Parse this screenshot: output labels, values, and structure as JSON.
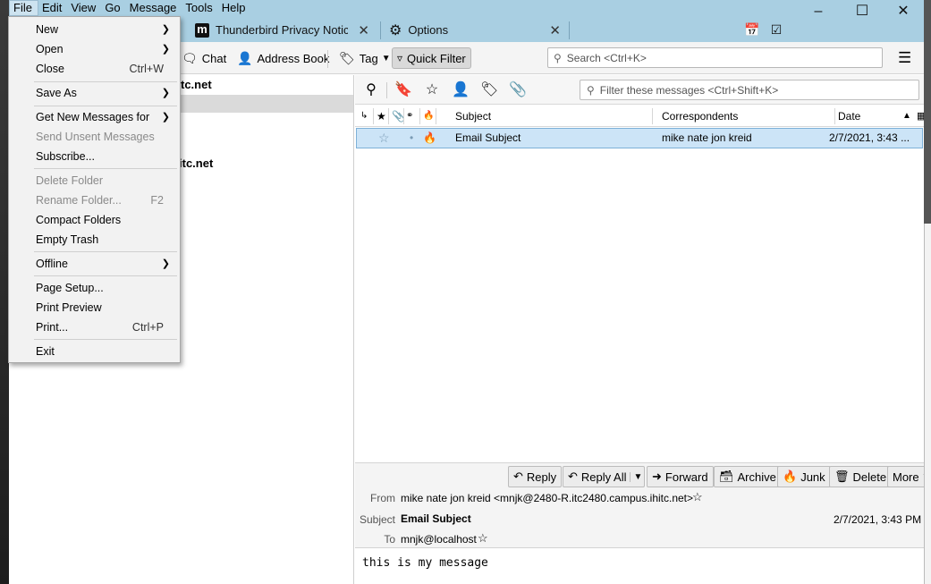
{
  "menubar": [
    "File",
    "Edit",
    "View",
    "Go",
    "Message",
    "Tools",
    "Help"
  ],
  "tabs": {
    "privacy": "Thunderbird Privacy Notice",
    "options": "Options"
  },
  "toolbar": {
    "chat": "Chat",
    "address_book": "Address Book",
    "tag": "Tag",
    "quick_filter": "Quick Filter",
    "search_placeholder": "Search <Ctrl+K>"
  },
  "folders": {
    "account1_suffix": "tc.net",
    "account2_suffix": "itc.net"
  },
  "quick_filter_bar": {
    "filter_placeholder": "Filter these messages <Ctrl+Shift+K>"
  },
  "thread_columns": {
    "subject": "Subject",
    "correspondents": "Correspondents",
    "date": "Date"
  },
  "messages": [
    {
      "subject": "Email Subject",
      "correspondents": "mike nate jon kreid",
      "date": "2/7/2021, 3:43 ..."
    }
  ],
  "header_buttons": {
    "reply": "Reply",
    "reply_all": "Reply All",
    "forward": "Forward",
    "archive": "Archive",
    "junk": "Junk",
    "delete": "Delete",
    "more": "More"
  },
  "message": {
    "from_label": "From",
    "from_value": "mike nate jon kreid <mnjk@2480-R.itc2480.campus.ihitc.net>",
    "subject_label": "Subject",
    "subject_value": "Email Subject",
    "date_value": "2/7/2021, 3:43 PM",
    "to_label": "To",
    "to_value": "mnjk@localhost",
    "body": "this is my message"
  },
  "file_menu": [
    {
      "label": "New",
      "shortcut": "",
      "submenu": true,
      "disabled": false
    },
    {
      "label": "Open",
      "shortcut": "",
      "submenu": true,
      "disabled": false
    },
    {
      "label": "Close",
      "shortcut": "Ctrl+W",
      "submenu": false,
      "disabled": false
    },
    {
      "label": "Save As",
      "shortcut": "",
      "submenu": true,
      "disabled": false
    },
    {
      "label": "Get New Messages for",
      "shortcut": "",
      "submenu": true,
      "disabled": false
    },
    {
      "label": "Send Unsent Messages",
      "shortcut": "",
      "submenu": false,
      "disabled": true
    },
    {
      "label": "Subscribe...",
      "shortcut": "",
      "submenu": false,
      "disabled": false
    },
    {
      "label": "Delete Folder",
      "shortcut": "",
      "submenu": false,
      "disabled": true
    },
    {
      "label": "Rename Folder...",
      "shortcut": "F2",
      "submenu": false,
      "disabled": true
    },
    {
      "label": "Compact Folders",
      "shortcut": "",
      "submenu": false,
      "disabled": false
    },
    {
      "label": "Empty Trash",
      "shortcut": "",
      "submenu": false,
      "disabled": false
    },
    {
      "label": "Offline",
      "shortcut": "",
      "submenu": true,
      "disabled": false
    },
    {
      "label": "Page Setup...",
      "shortcut": "",
      "submenu": false,
      "disabled": false
    },
    {
      "label": "Print Preview",
      "shortcut": "",
      "submenu": false,
      "disabled": false
    },
    {
      "label": "Print...",
      "shortcut": "Ctrl+P",
      "submenu": false,
      "disabled": false
    },
    {
      "label": "Exit",
      "shortcut": "",
      "submenu": false,
      "disabled": false
    }
  ],
  "colors": {
    "titlebar": "#a9cfe2",
    "selected_row": "#cce4f7",
    "menu_bg": "#f2f2f2"
  }
}
